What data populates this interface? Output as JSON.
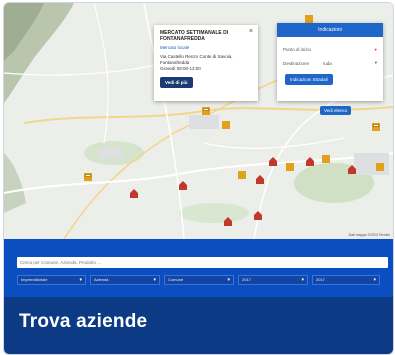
{
  "popup": {
    "title": "MERCATO SETTIMANALE DI FONTANAFREDDA",
    "link": "Mercato locale",
    "address": "Via Castello Renzo Conte di Savoia, Fontanafredda",
    "hours": "Giovedì 08:00-13:00",
    "button": "Vedi di più",
    "close": "×"
  },
  "panel": {
    "header": "Indicazioni",
    "start_label": "Punto di inizio",
    "dest_label": "Destinazione",
    "dest_value": "Iuda",
    "button": "Indicazioni Stradali"
  },
  "map": {
    "show_list": "Vedi elenco",
    "footer": "Dati mappa ©2023  Termini"
  },
  "search": {
    "placeholder": "Cerca per Comune, Azienda, Prodotto ...",
    "filters": [
      "Imprenditoriale",
      "Azienda",
      "Comune",
      "2017",
      "2017"
    ]
  },
  "banner": {
    "title": "Trova aziende"
  },
  "colors": {
    "accent": "#1e66c7",
    "banner": "#0c3a85",
    "search": "#0b4ec1",
    "marker": "#c0392b"
  }
}
